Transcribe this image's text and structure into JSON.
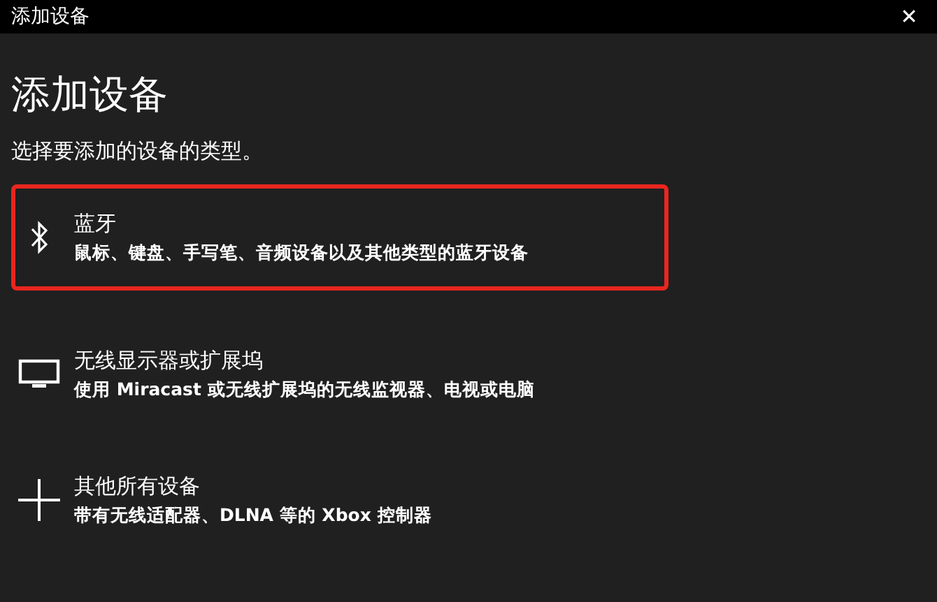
{
  "window": {
    "title": "添加设备",
    "close": "✕"
  },
  "heading": "添加设备",
  "subtitle": "选择要添加的设备的类型。",
  "options": [
    {
      "kind": "bluetooth",
      "title": "蓝牙",
      "description": "鼠标、键盘、手写笔、音频设备以及其他类型的蓝牙设备",
      "highlighted": true
    },
    {
      "kind": "display",
      "title": "无线显示器或扩展坞",
      "description": "使用 Miracast 或无线扩展坞的无线监视器、电视或电脑",
      "highlighted": false
    },
    {
      "kind": "other",
      "title": "其他所有设备",
      "description": "带有无线适配器、DLNA 等的 Xbox 控制器",
      "highlighted": false
    }
  ]
}
